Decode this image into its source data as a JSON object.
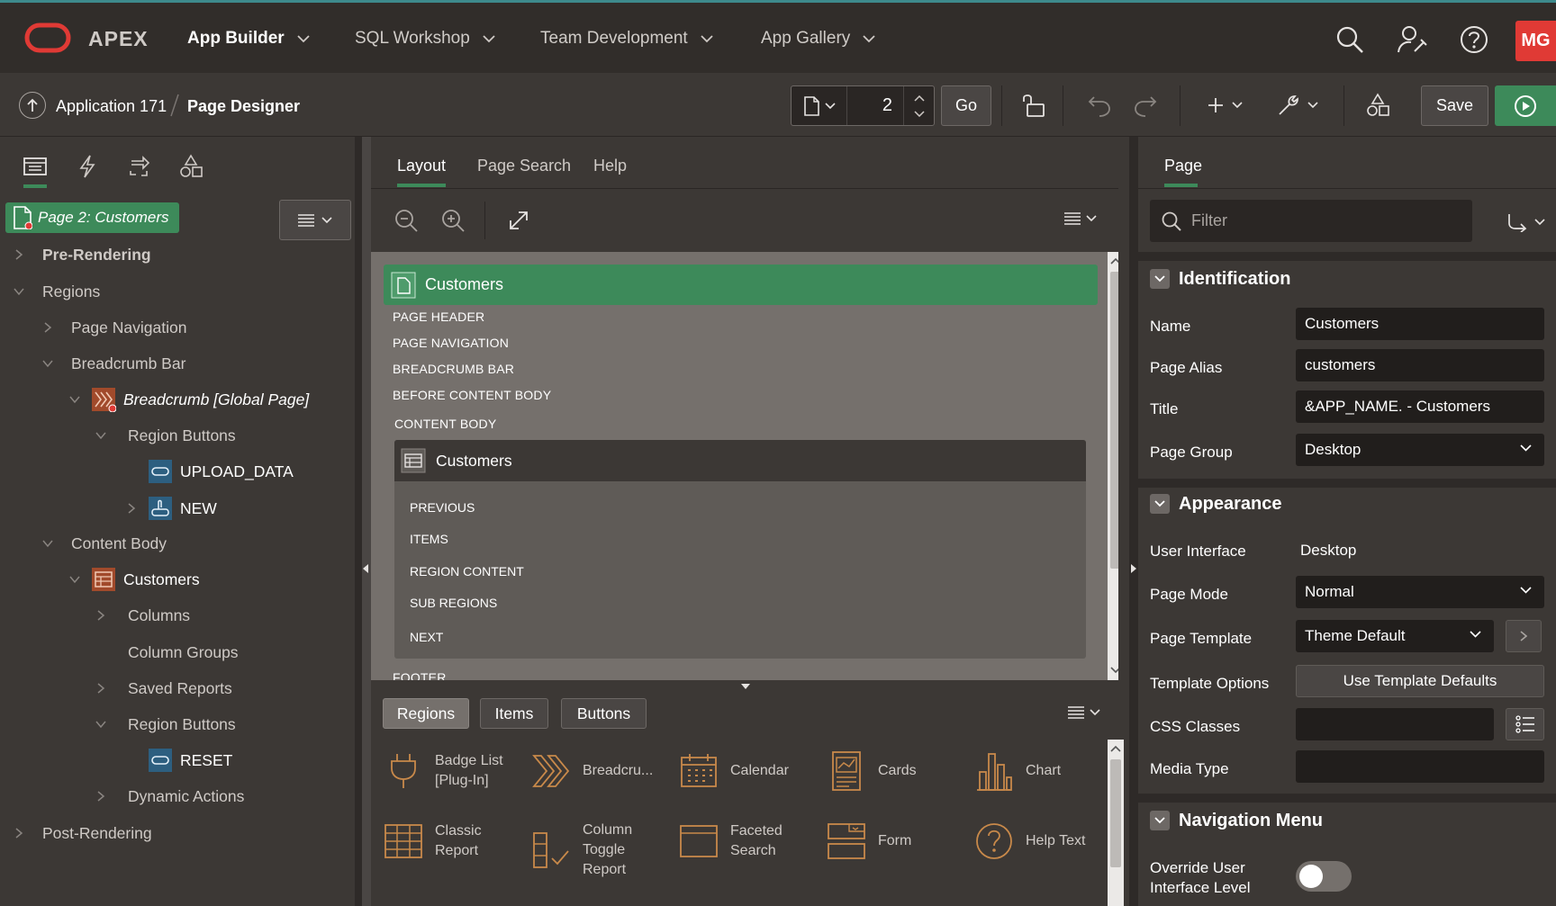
{
  "topnav": {
    "brand": "APEX",
    "items": [
      "App Builder",
      "SQL Workshop",
      "Team Development",
      "App Gallery"
    ],
    "avatar": "MG",
    "icons": [
      "search-icon",
      "user-settings-icon",
      "help-icon"
    ]
  },
  "toolbar": {
    "crumb_app": "Application 171",
    "crumb_page": "Page Designer",
    "page_number": "2",
    "go_label": "Go",
    "save_label": "Save"
  },
  "left": {
    "page_badge": "Page 2: Customers",
    "tree": {
      "pre_rendering": "Pre-Rendering",
      "regions": "Regions",
      "page_navigation": "Page Navigation",
      "breadcrumb_bar": "Breadcrumb Bar",
      "breadcrumb_global": "Breadcrumb [Global Page]",
      "region_buttons_1": "Region Buttons",
      "upload_data": "UPLOAD_DATA",
      "new": "NEW",
      "content_body": "Content Body",
      "customers": "Customers",
      "columns": "Columns",
      "column_groups": "Column Groups",
      "saved_reports": "Saved Reports",
      "region_buttons_2": "Region Buttons",
      "reset": "RESET",
      "dynamic_actions": "Dynamic Actions",
      "post_rendering": "Post-Rendering"
    }
  },
  "center": {
    "tabs": [
      "Layout",
      "Page Search",
      "Help"
    ],
    "canvas": {
      "page_title": "Customers",
      "slots": [
        "PAGE HEADER",
        "PAGE NAVIGATION",
        "BREADCRUMB BAR",
        "BEFORE CONTENT BODY",
        "CONTENT BODY"
      ],
      "region_title": "Customers",
      "region_slots": [
        "PREVIOUS",
        "ITEMS",
        "REGION CONTENT",
        "SUB REGIONS",
        "NEXT"
      ],
      "footer_slot": "FOOTER"
    },
    "gallery_tabs": [
      "Regions",
      "Items",
      "Buttons"
    ],
    "gallery": [
      {
        "label": "Badge List [Plug-In]",
        "icon": "badge-list-icon"
      },
      {
        "label": "Breadcru...",
        "icon": "breadcrumb-icon"
      },
      {
        "label": "Calendar",
        "icon": "calendar-icon"
      },
      {
        "label": "Cards",
        "icon": "cards-icon"
      },
      {
        "label": "Chart",
        "icon": "chart-icon"
      },
      {
        "label": "Classic Report",
        "icon": "classic-report-icon"
      },
      {
        "label": "Column Toggle Report",
        "icon": "column-toggle-icon"
      },
      {
        "label": "Faceted Search",
        "icon": "faceted-search-icon"
      },
      {
        "label": "Form",
        "icon": "form-icon"
      },
      {
        "label": "Help Text",
        "icon": "help-text-icon"
      }
    ]
  },
  "right": {
    "tab": "Page",
    "filter_placeholder": "Filter",
    "identification": {
      "title": "Identification",
      "name_label": "Name",
      "name_value": "Customers",
      "alias_label": "Page Alias",
      "alias_value": "customers",
      "title_label": "Title",
      "title_value": "&APP_NAME. - Customers",
      "group_label": "Page Group",
      "group_value": "Desktop"
    },
    "appearance": {
      "title": "Appearance",
      "ui_label": "User Interface",
      "ui_value": "Desktop",
      "mode_label": "Page Mode",
      "mode_value": "Normal",
      "template_label": "Page Template",
      "template_value": "Theme Default",
      "options_label": "Template Options",
      "options_button": "Use Template Defaults",
      "css_label": "CSS Classes",
      "css_value": "",
      "media_label": "Media Type",
      "media_value": ""
    },
    "navigation_menu": {
      "title": "Navigation Menu",
      "override_label_1": "Override User",
      "override_label_2": "Interface Level",
      "override_on": false
    }
  },
  "colors": {
    "accent_green": "#3d8a5a",
    "brand_red": "#e03a35",
    "teal_line": "#3d8a8c"
  }
}
